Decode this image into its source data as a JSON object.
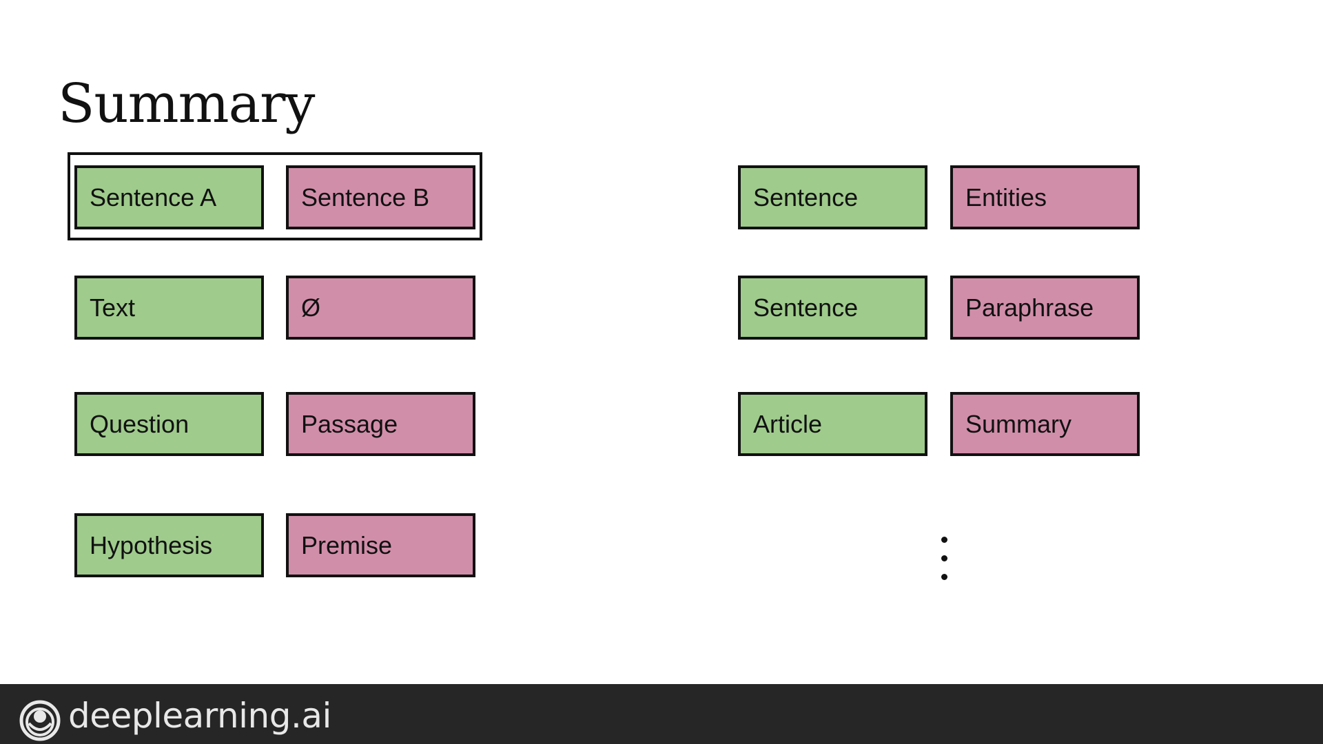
{
  "title": "Summary",
  "left_rows": [
    {
      "input": "Sentence A",
      "context": "Sentence B"
    },
    {
      "input": "Text",
      "context": "Ø"
    },
    {
      "input": "Question",
      "context": "Passage"
    },
    {
      "input": "Hypothesis",
      "context": "Premise"
    }
  ],
  "right_rows": [
    {
      "input": "Sentence",
      "context": "Entities"
    },
    {
      "input": "Sentence",
      "context": "Paraphrase"
    },
    {
      "input": "Article",
      "context": "Summary"
    }
  ],
  "continuation": "⋮",
  "footer": {
    "brand": "deeplearning.ai",
    "logo_icon": "deeplearning-logo-icon"
  },
  "colors": {
    "green": "#9fcb8c",
    "pink": "#d18ea9",
    "footer_bg": "#262626"
  }
}
